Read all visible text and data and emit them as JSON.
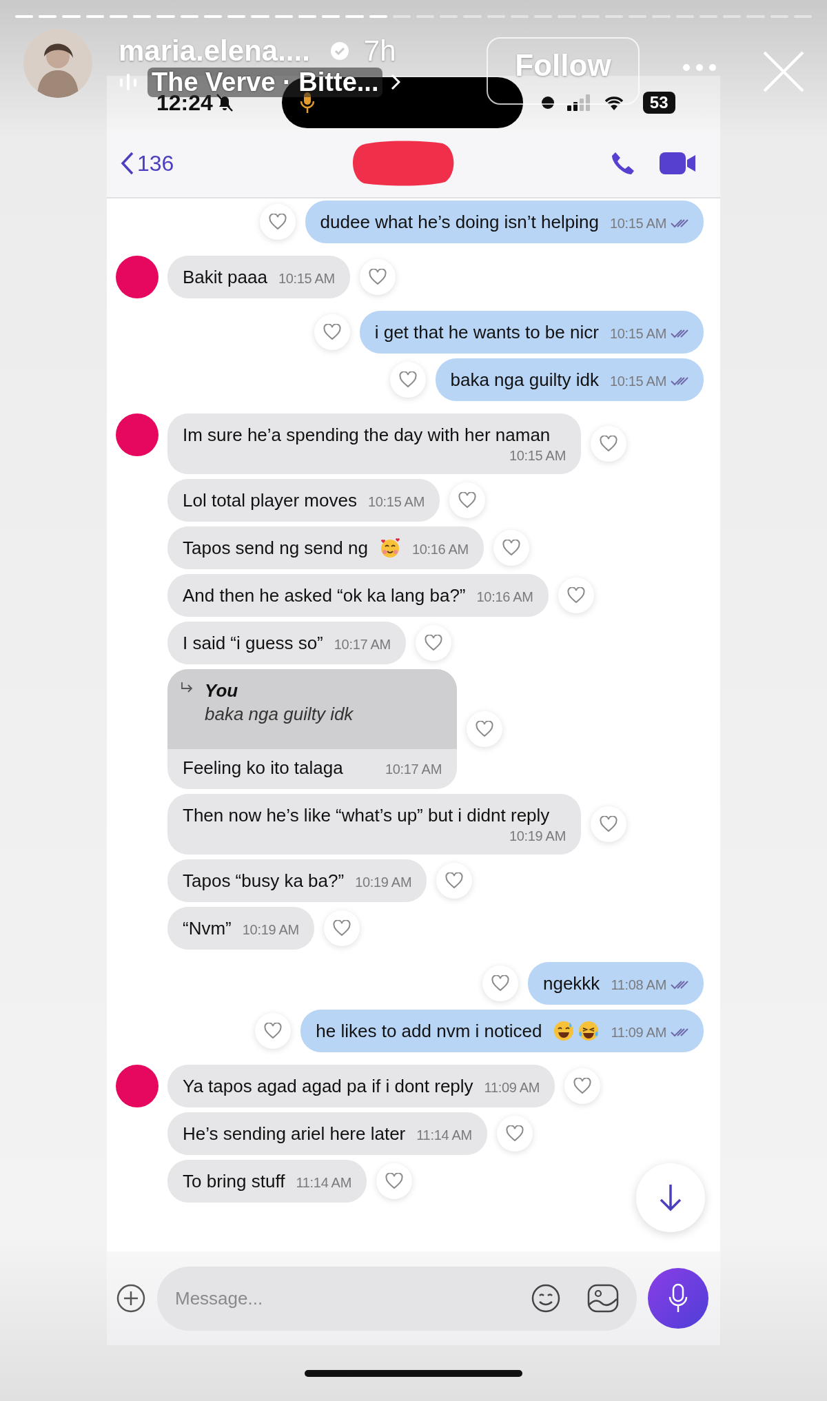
{
  "story": {
    "segments": [
      {
        "viewed": true
      },
      {
        "viewed": true
      },
      {
        "viewed": true
      },
      {
        "viewed": true
      },
      {
        "viewed": true
      },
      {
        "viewed": true
      },
      {
        "viewed": true
      },
      {
        "viewed": true
      },
      {
        "viewed": true
      },
      {
        "viewed": true
      },
      {
        "viewed": true
      },
      {
        "viewed": true
      },
      {
        "viewed": true
      },
      {
        "viewed": true
      },
      {
        "viewed": true
      },
      {
        "viewed": true
      },
      {
        "viewed": false
      },
      {
        "viewed": false
      },
      {
        "viewed": false
      },
      {
        "viewed": false
      },
      {
        "viewed": false
      },
      {
        "viewed": false
      },
      {
        "viewed": false
      },
      {
        "viewed": false
      },
      {
        "viewed": false
      },
      {
        "viewed": false
      },
      {
        "viewed": false
      },
      {
        "viewed": false
      },
      {
        "viewed": false
      },
      {
        "viewed": false
      },
      {
        "viewed": false
      },
      {
        "viewed": false
      },
      {
        "viewed": false
      },
      {
        "viewed": false
      }
    ],
    "username": "maria.elena....",
    "verified": true,
    "age": "7h",
    "follow_button": "Follow",
    "music": "The Verve · Bitte..."
  },
  "status_bar": {
    "time": "12:24",
    "muted": true,
    "mic_in_use": true,
    "battery": "53"
  },
  "chat_header": {
    "back_count": "136",
    "name_redacted": true
  },
  "messages": [
    {
      "kind": "sent",
      "text": "dudee what he’s doing isn’t helping",
      "time": "10:15 AM",
      "read": true
    },
    {
      "kind": "received",
      "avatar": true,
      "text": "Bakit paaa",
      "time": "10:15 AM"
    },
    {
      "kind": "sent",
      "text": "i get that he wants to be nicr",
      "time": "10:15 AM",
      "read": true
    },
    {
      "kind": "sent",
      "text": "baka nga guilty idk",
      "time": "10:15 AM",
      "read": true
    },
    {
      "kind": "received",
      "avatar": true,
      "text": "Im sure he’a spending the day with her naman",
      "time": "10:15 AM"
    },
    {
      "kind": "received",
      "avatar": false,
      "text": "Lol total player moves",
      "time": "10:15 AM"
    },
    {
      "kind": "received",
      "avatar": false,
      "text": "Tapos send ng send ng",
      "emojis": [
        {
          "kind": "hearts-face"
        }
      ],
      "time": "10:16 AM"
    },
    {
      "kind": "received",
      "avatar": false,
      "text": "And then he asked “ok ka lang ba?”",
      "time": "10:16 AM"
    },
    {
      "kind": "received",
      "avatar": false,
      "text": "I said “i guess so”",
      "time": "10:17 AM"
    },
    {
      "kind": "received",
      "avatar": false,
      "reply_to": {
        "author": "You",
        "text": "baka nga guilty idk"
      },
      "text": "Feeling ko ito talaga",
      "time": "10:17 AM"
    },
    {
      "kind": "received",
      "avatar": false,
      "text": "Then now he’s like “what’s up” but i didnt reply",
      "time": "10:19 AM"
    },
    {
      "kind": "received",
      "avatar": false,
      "text": "Tapos “busy ka ba?”",
      "time": "10:19 AM"
    },
    {
      "kind": "received",
      "avatar": false,
      "text": "“Nvm”",
      "time": "10:19 AM"
    },
    {
      "kind": "sent",
      "text": "ngekkk",
      "time": "11:08 AM",
      "read": true
    },
    {
      "kind": "sent",
      "text": "he likes to add nvm i noticed",
      "emojis": [
        {
          "kind": "sweat-smile"
        },
        {
          "kind": "tears-of-joy"
        }
      ],
      "time": "11:09 AM",
      "read": true
    },
    {
      "kind": "received",
      "avatar": true,
      "text": "Ya tapos agad agad pa if i dont reply",
      "time": "11:09 AM"
    },
    {
      "kind": "received",
      "avatar": false,
      "text": "He’s sending ariel here later",
      "time": "11:14 AM"
    },
    {
      "kind": "received",
      "avatar": false,
      "text": "To bring stuff",
      "time": "11:14 AM"
    }
  ],
  "composer": {
    "placeholder": "Message..."
  }
}
